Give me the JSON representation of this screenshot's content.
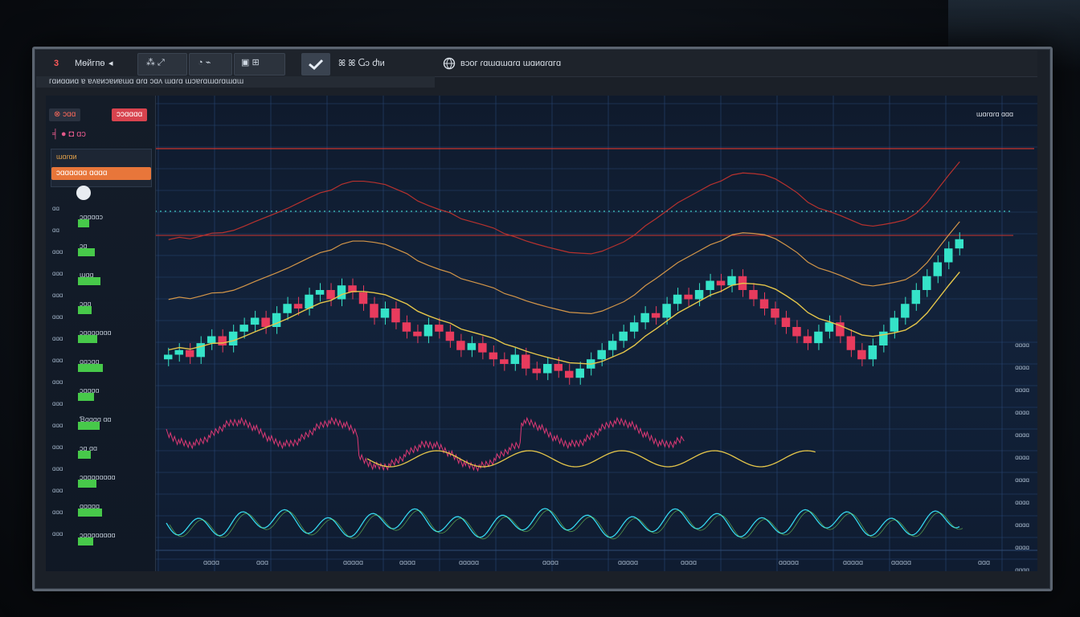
{
  "topbar": {
    "brand_glyph": "3",
    "brand_label": "Mѳйгпө",
    "brand_arrow": "◂",
    "tool1": "⁂ ⤢",
    "tool2": "◔ ⌁",
    "tool3": "▣ ⊞",
    "check_icon": "check-icon",
    "tool4": "ꕤ ꕤ  Ⴚɔ Ⴛᴎ",
    "globe_icon": "globe-icon",
    "status": "вɔоᴦ ɾɑɯɑɯɑɾɑ ɯɑᴎɑɾɑᴦɑ"
  },
  "subbar": {
    "text": "ᴦɑᴎɑɑᴎɑ ɐ ɐʌɐᴎɔɐᴎɐɯɑ ɑɾɑ ɔɑʌ ɯɑɾɑ ɯɔɐɾɑɯɑɾɑɯɑɯ"
  },
  "left_panel": {
    "tag_a": "⊗ ɔɑɑ",
    "tag_b": "ɔɔɑɑɑɑ",
    "icons_row": "╡   ●   ◘   ɑɔ",
    "label_orange_top": "ɯɑɾɑᴎ",
    "label_orange_value": "ɔɑɑɑɑɑɑ  ɑɑɑɑ",
    "rows": [
      "ɔɑɑɑɑɔ",
      "ɔɑ",
      "ɯɑɑ",
      "ɔɑɑ",
      "ɔɑɑɑɑɑɑɑ",
      "ɑɑɔɑɑ",
      "ɔɑɑɑɑ",
      "Ɓɑɑɑɑ  ɑɑ",
      "ɔɑ  ɑɑ",
      "ɔɑɑɑɑɑɑɑɑ",
      "ɑɑɑɑɑ",
      "ɔɑɑɑɑɑɑɑɑ"
    ],
    "axis": [
      "ɑɑ",
      "ɑɑ",
      "ɑɑɑ",
      "ɑɑɑ",
      "ɑɑɑ",
      "ɑɑɑ",
      "ɑɑɑ",
      "ɑɑɑ",
      "ɑɑɑ",
      "ɑɑɑ",
      "ɑɑɑ",
      "ɑɑɑ",
      "ɑɑɑ",
      "ɑɑɑ",
      "ɑɑɑ",
      "ɑɑɑ"
    ]
  },
  "right_panel": {
    "header": "ɯɑɾɑɾɑ ɑɑɑ",
    "axis": [
      "ɑɑɑɑ",
      "ɑɑɑɑ",
      "ɑɑɑɑ",
      "ɑɑɑɑ",
      "ɑɑɑɑ",
      "ɑɑɑɑ",
      "ɑɑɑɑ",
      "ɑɑɑɑ",
      "ɑɑɑɑ",
      "ɑɑɑɑ",
      "ɑɑɑɑ"
    ]
  },
  "bottom_axis": [
    "ɑɑɑɑ",
    "ɑɑɑ",
    "ɑɑɑɑɑ",
    "ɑɑɑɑ",
    "ɑɑɑɑɑ",
    "ɑɑɑɑ",
    "ɑɑɑɑɑ",
    "ɑɑɑɑ",
    "ɑɑɑɑɑ",
    "ɑɑɑɑɑ",
    "ɑɑɑɑɑ",
    "ɑɑɑ"
  ],
  "colors": {
    "up": "#35e3c8",
    "down": "#e83b5d",
    "ma_yellow": "#e5c64a",
    "ma_orange": "#e9a24a",
    "ma_red": "#c9342e",
    "grid": "#2a4a7a",
    "accent_orange": "#e8763a"
  },
  "chart_data": {
    "type": "candlestick",
    "candles_close": [
      50,
      52,
      49,
      55,
      58,
      54,
      60,
      63,
      66,
      62,
      68,
      72,
      70,
      76,
      78,
      74,
      80,
      77,
      72,
      66,
      70,
      64,
      60,
      58,
      63,
      60,
      56,
      52,
      55,
      51,
      48,
      46,
      50,
      44,
      42,
      46,
      43,
      40,
      44,
      48,
      52,
      56,
      60,
      64,
      68,
      66,
      72,
      76,
      74,
      78,
      82,
      80,
      84,
      78,
      74,
      70,
      66,
      62,
      58,
      55,
      60,
      64,
      58,
      52,
      48,
      54,
      60,
      66,
      72,
      78,
      84,
      90,
      96,
      100
    ]
  }
}
